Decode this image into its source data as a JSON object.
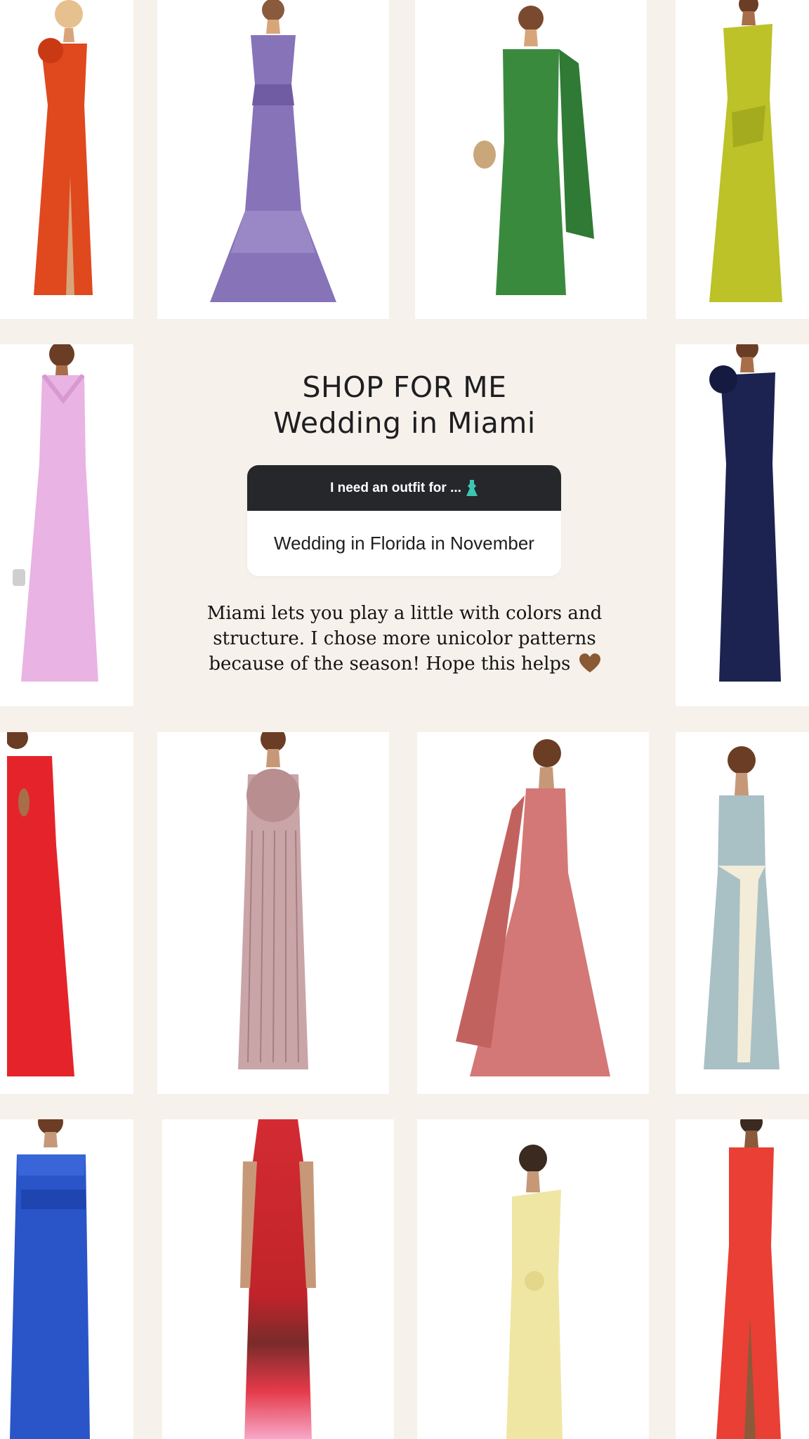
{
  "header": {
    "title_line1": "SHOP FOR ME",
    "title_line2": "Wedding in Miami"
  },
  "prompt": {
    "question": "I need an outfit for ...",
    "question_emoji": "dress-emoji",
    "answer": "Wedding in Florida in November"
  },
  "caption": {
    "text": "Miami lets you play a little with colors and structure. I chose more unicolor patterns because of the season! Hope this helps",
    "emoji": "brown-heart-emoji"
  },
  "products": [
    {
      "name": "orange-one-shoulder-gown",
      "color": "#e0481e",
      "style": "rosette-slit"
    },
    {
      "name": "purple-floral-halter-gown",
      "color": "#8773b8",
      "style": "halter-ruffle"
    },
    {
      "name": "green-satin-cape-gown",
      "color": "#3a8a3e",
      "style": "cape"
    },
    {
      "name": "chartreuse-one-shoulder-gown",
      "color": "#bcc227",
      "style": "one-shoulder"
    },
    {
      "name": "pink-satin-halter-gown",
      "color": "#e9b3e3",
      "style": "halter"
    },
    {
      "name": "navy-one-shoulder-gown",
      "color": "#1c2350",
      "style": "rosette"
    },
    {
      "name": "red-cutout-gown",
      "color": "#e4242a",
      "style": "cutout"
    },
    {
      "name": "mauve-pleated-flower-gown",
      "color": "#c9a5a8",
      "style": "pleated-flower"
    },
    {
      "name": "rose-satin-drape-gown",
      "color": "#d37877",
      "style": "drape"
    },
    {
      "name": "sage-sash-halter-gown",
      "color": "#a9c0c5",
      "style": "sash"
    },
    {
      "name": "blue-strapless-belted-gown",
      "color": "#2a55c8",
      "style": "strapless-belt"
    },
    {
      "name": "red-ombre-mockneck-gown",
      "color": "#d42b33",
      "style": "ombre"
    },
    {
      "name": "butter-yellow-draped-gown",
      "color": "#f0e6a3",
      "style": "one-shoulder"
    },
    {
      "name": "coral-halter-slit-gown",
      "color": "#ea3f34",
      "style": "halter-slit"
    }
  ]
}
